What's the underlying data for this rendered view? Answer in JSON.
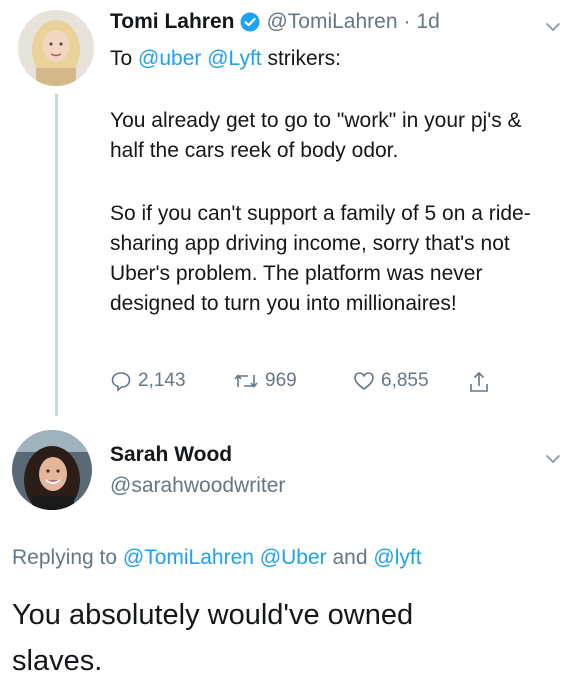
{
  "tweet1": {
    "display_name": "Tomi Lahren",
    "handle": "@TomiLahren",
    "separator": "·",
    "time": "1d",
    "reply_prefix": "To",
    "mention1": "@uber",
    "mention2": "@Lyft",
    "reply_suffix": "strikers:",
    "paragraph1": "You already get to go to \"work\" in your pj's & half the cars reek of body odor.",
    "paragraph2": "So if you can't support a family of 5 on a ride-sharing app driving income, sorry that's not Uber's problem. The platform was never designed to turn you into millionaires!",
    "replies": "2,143",
    "retweets": "969",
    "likes": "6,855"
  },
  "tweet2": {
    "display_name": "Sarah Wood",
    "handle": "@sarahwoodwriter",
    "replying_label": "Replying to",
    "replying_to1": "@TomiLahren",
    "replying_to2": "@Uber",
    "replying_and": "and",
    "replying_to3": "@lyft",
    "text": "You absolutely would've owned slaves."
  },
  "colors": {
    "link": "#1da1f2",
    "muted": "#657786",
    "verified": "#1da1f2",
    "thread_line": "#ccd6dd"
  }
}
